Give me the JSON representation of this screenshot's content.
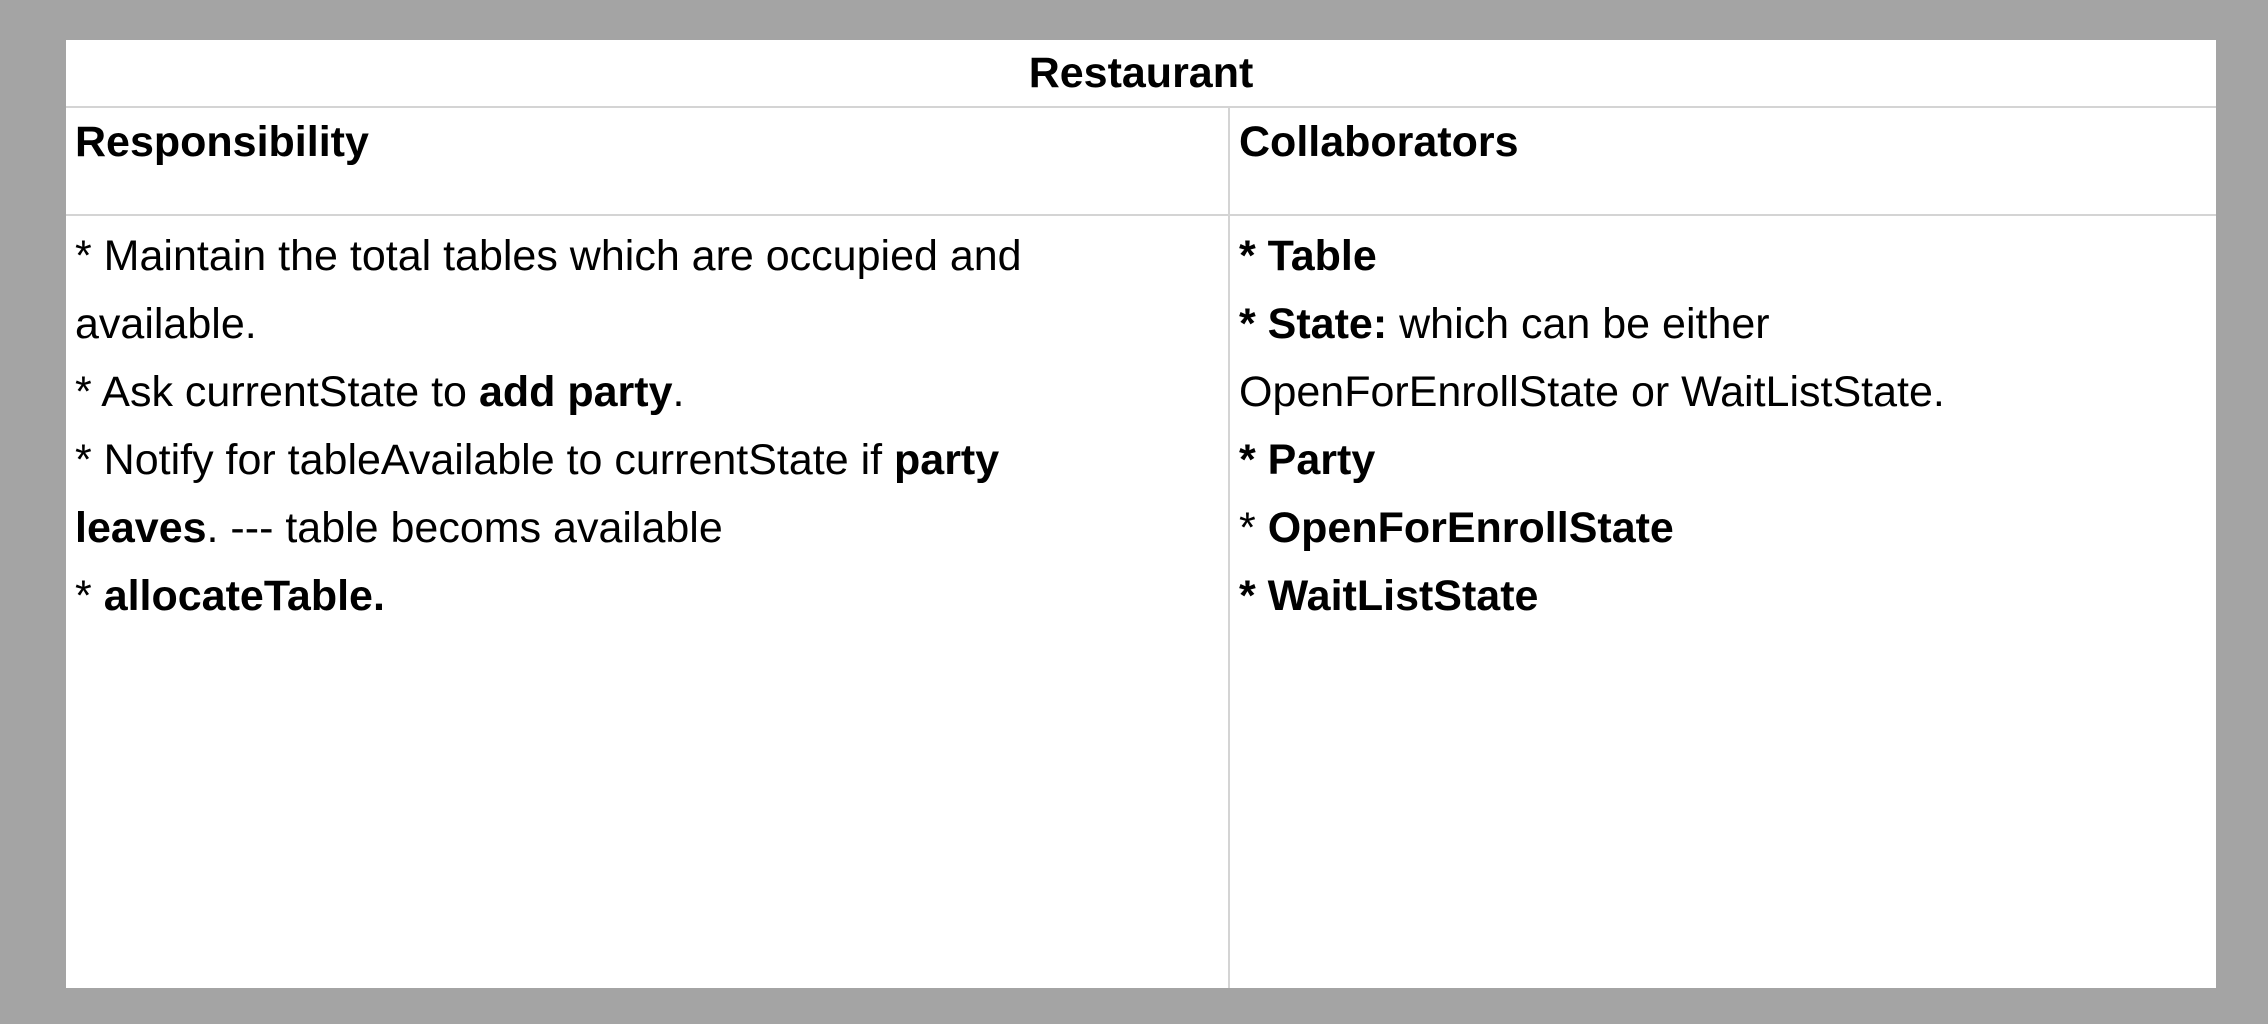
{
  "title": "Restaurant",
  "headers": {
    "responsibility": "Responsibility",
    "collaborators": "Collaborators"
  },
  "responsibility_lines": [
    [
      {
        "t": "* Maintain the total tables which are occupied and",
        "b": false
      }
    ],
    [
      {
        "t": "available.",
        "b": false
      }
    ],
    [
      {
        "t": "* Ask currentState to ",
        "b": false
      },
      {
        "t": "add party",
        "b": true
      },
      {
        "t": ".",
        "b": false
      }
    ],
    [
      {
        "t": "* Notify for tableAvailable to currentState if ",
        "b": false
      },
      {
        "t": "party",
        "b": true
      }
    ],
    [
      {
        "t": "leaves",
        "b": true
      },
      {
        "t": ". --- table becoms available",
        "b": false
      }
    ],
    [
      {
        "t": "* ",
        "b": false
      },
      {
        "t": "allocateTable.",
        "b": true
      }
    ]
  ],
  "collaborator_lines": [
    [
      {
        "t": "* Table",
        "b": true
      }
    ],
    [
      {
        "t": "* State:",
        "b": true
      },
      {
        "t": " which can be either",
        "b": false
      }
    ],
    [
      {
        "t": "OpenForEnrollState or WaitListState.",
        "b": false
      }
    ],
    [
      {
        "t": "* Party",
        "b": true
      }
    ],
    [
      {
        "t": "* ",
        "b": false
      },
      {
        "t": "OpenForEnrollState",
        "b": true
      }
    ],
    [
      {
        "t": "* WaitListState",
        "b": true
      }
    ]
  ]
}
